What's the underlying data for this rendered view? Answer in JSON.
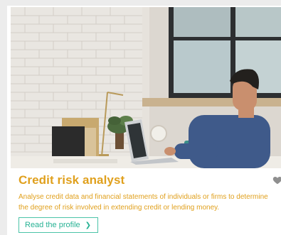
{
  "card": {
    "title": "Credit risk analyst",
    "description_lines": [
      "Analyse credit data and financial statements of individuals or firms to determine",
      "the degree of risk involved in extending credit or lending money."
    ],
    "cta_label": "Read the profile",
    "cta_icon": "chevron-right-icon",
    "favorite_icon": "heart-icon"
  },
  "colors": {
    "accent": "#e0a01d",
    "cta": "#27b294",
    "cta_border": "#4cc3a8"
  }
}
